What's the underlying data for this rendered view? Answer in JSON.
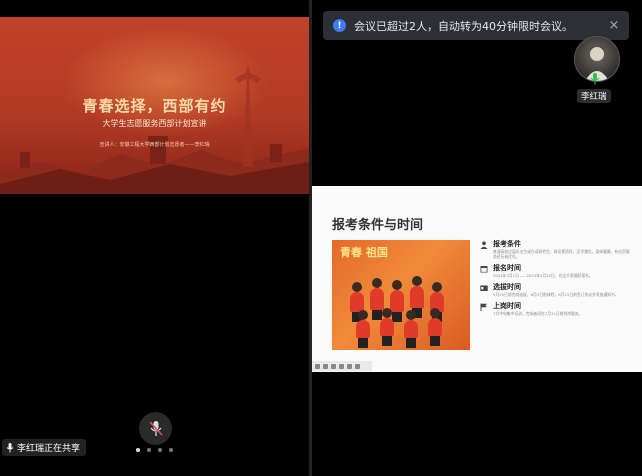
{
  "notification": {
    "text": "会议已超过2人，自动转为40分钟限时会议。",
    "icon": "info-icon",
    "close": "×"
  },
  "participant": {
    "name": "李红瑞",
    "mic_icon": "mic-on-icon"
  },
  "slide1": {
    "title": "青春选择，西部有约",
    "subtitle": "大学生志愿服务西部计划宣讲",
    "speaker": "宣讲人：安徽工程大学西部计划志愿者——李红瑞"
  },
  "slide2": {
    "title": "报考条件与时间",
    "photo_banner": "青春 祖国",
    "items": [
      {
        "icon": "user-icon",
        "heading": "报考条件",
        "body": "普通高校应届毕业生或在读研究生，政治素质好，品学兼优，身体健康，有志愿服务经历者优先。"
      },
      {
        "icon": "calendar-icon",
        "heading": "报名时间",
        "body": "2024年3月1日——2024年5月20日，在这大家踊跃报名。"
      },
      {
        "icon": "id-card-icon",
        "heading": "选拔时间",
        "body": "5月25日前完成选拔，6月5日前体检，6月15日前签订协议并发放通知书。"
      },
      {
        "icon": "flag-icon",
        "heading": "上岗时间",
        "body": "7月中旬集中培训，完成者须在7月31日前到岗服务。"
      }
    ]
  },
  "share_status": {
    "text": "李红瑞正在共享",
    "icon": "mic-icon"
  },
  "controls": {
    "mute_icon": "mic-muted-icon",
    "page_dots": 4,
    "active_dot": 0
  },
  "colors": {
    "slide1_bg": "#b13a24",
    "notice_bg": "#2d2f36",
    "info_blue": "#3d7cf4",
    "mic_green": "#2fbf4a",
    "mute_red": "#e05050"
  }
}
